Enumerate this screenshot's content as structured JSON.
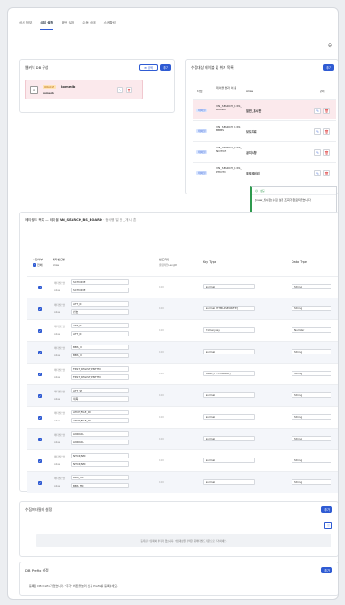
{
  "tabs": [
    "상세 정보",
    "수집 설정",
    "패턴 설정",
    "수동 상태",
    "스케줄링"
  ],
  "active_tab": 1,
  "collapse_icon": "⊖",
  "db_card": {
    "title": "웹커넥 DB 구성",
    "search_label": "검색",
    "add_label": "추가",
    "db_badge": "ORACLE",
    "db_name": "homedb",
    "db_sub": "homedb"
  },
  "target_card": {
    "title": "수집대상 테이블 및 취지 목록",
    "add_label": "추가",
    "columns": [
      "타입",
      "테이블 명과 이 름",
      "Alias",
      "관리"
    ],
    "rows": [
      {
        "type": "테이블",
        "name": "VN_SEARCH_B RS_BOARD",
        "alias": "일반_게시판",
        "pink": true
      },
      {
        "type": "테이블",
        "name": "VN_SEARCH_B RS_BBBS",
        "alias": "보도자료",
        "pink": false
      },
      {
        "type": "테이블",
        "name": "VN_SEARCH_B RS_NOTICE",
        "alias": "공지사항",
        "pink": false
      },
      {
        "type": "테이블",
        "name": "VN_SEARCH_B RS_PHOTO",
        "alias": "포토갤러리",
        "pink": false
      }
    ]
  },
  "toasts": [
    {
      "title": "성공",
      "message": "[new_게시판] 수집 설정 조회가 완료되었습니다."
    },
    {
      "title": "성공",
      "message": "[new_게시판] 상세 정보를 불러왔습니다."
    }
  ],
  "mapping_card": {
    "title_prefix": "메타필드 목록 — 테이블 ",
    "table_name": "VN_SEARCH_BS_BOARD",
    "title_suffix": " · 등시행 일 한 _개 시 혼",
    "col_collect": "수집여부",
    "col_all": "전체",
    "col_field": "메타필드명",
    "col_alias": "Alias",
    "col_length": "필드타입",
    "col_length_sub": "컬럼타입 Length",
    "col_keytype": "Key Type",
    "col_datatype": "Data Type",
    "field_label": "메타필드명",
    "alias_label": "Alias",
    "rows": [
      {
        "field": "SCTCODE",
        "alias": "SCTCODE",
        "length": "100",
        "keytype": "Normal",
        "datatype": "String"
      },
      {
        "field": "ATT_ID",
        "alias": "번호",
        "length": "100",
        "keytype": "Normal [HTML&SECRETE]",
        "datatype": "String"
      },
      {
        "field": "ATT_ID",
        "alias": "ATT_ID",
        "length": "100",
        "keytype": "PrimaryKey",
        "datatype": "Number"
      },
      {
        "field": "BBS_ID",
        "alias": "BBS_ID",
        "length": "100",
        "keytype": "Normal",
        "datatype": "String"
      },
      {
        "field": "FRST_REGIST_PNTTM",
        "alias": "FRST_REGIST_PNTTM",
        "length": "100",
        "keytype": "Date [YYYY-MM-DD]",
        "datatype": "String"
      },
      {
        "field": "ATT_ST",
        "alias": "제목",
        "length": "100",
        "keytype": "Normal",
        "datatype": "String"
      },
      {
        "field": "ATCH_FILE_ID",
        "alias": "ATCH_FILE_ID",
        "length": "100",
        "keytype": "Normal",
        "datatype": "String"
      },
      {
        "field": "LINKURL",
        "alias": "LINKURL",
        "length": "100",
        "keytype": "Normal",
        "datatype": "String"
      },
      {
        "field": "NTCR_NM",
        "alias": "NTCR_NM",
        "length": "100",
        "keytype": "Normal",
        "datatype": "String"
      },
      {
        "field": "BBS_NM",
        "alias": "BBS_NM",
        "length": "100",
        "keytype": "Normal",
        "datatype": "String"
      }
    ]
  },
  "filter_card": {
    "title": "수집메타필터 설정",
    "add_label": "추가",
    "empty_text": "등록된 수집제외 필터가 없습니다. 수집대상을 선택한 뒤 메타필드 기준으로 추가하세요."
  },
  "prefix_card": {
    "title": "DB Prefix 설정",
    "add_label": "추가",
    "empty_text": "등록된 DB Prefix가 없습니다. \"추가\" 버튼을 눌러 신규 Prefix를 등록하세요."
  }
}
